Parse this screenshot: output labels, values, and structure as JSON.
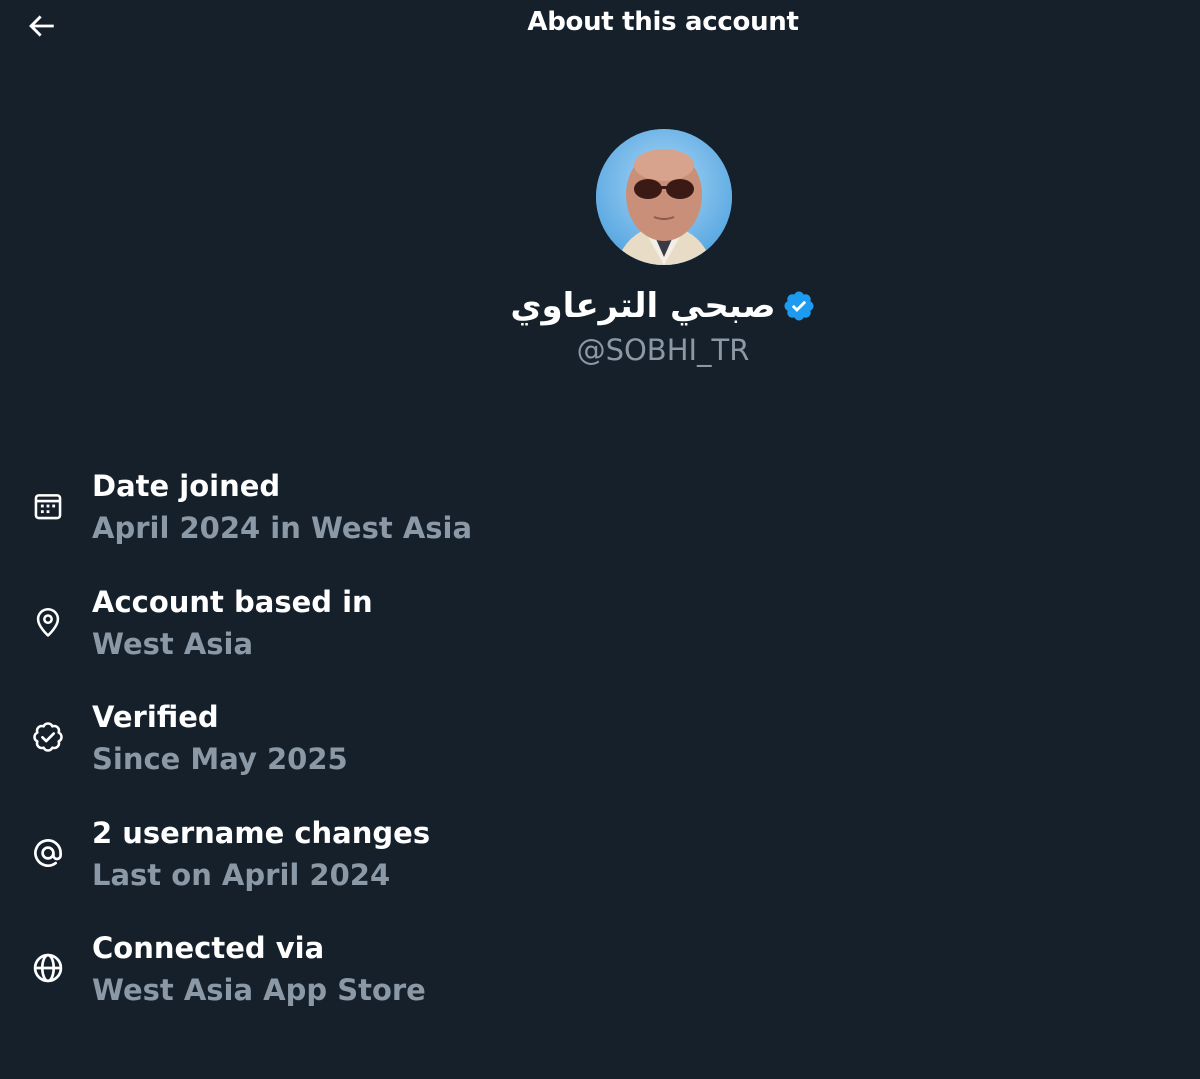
{
  "header": {
    "title": "About this account",
    "back_icon": "arrow-left-icon"
  },
  "profile": {
    "display_name": "صبحي الترعاوي",
    "handle": "@SOBHI_TR",
    "verified": true,
    "badge_color": "#1d9bf0"
  },
  "details": [
    {
      "icon": "calendar-icon",
      "title": "Date joined",
      "value": "April 2024 in West Asia"
    },
    {
      "icon": "location-pin-icon",
      "title": "Account based in",
      "value": "West Asia"
    },
    {
      "icon": "verified-badge-icon",
      "title": "Verified",
      "value": "Since May 2025"
    },
    {
      "icon": "at-sign-icon",
      "title": "2 username changes",
      "value": "Last on April 2024"
    },
    {
      "icon": "globe-icon",
      "title": "Connected via",
      "value": "West Asia App Store"
    }
  ],
  "colors": {
    "background": "#15202b",
    "primary_text": "#ffffff",
    "secondary_text": "#8b98a5",
    "accent": "#1d9bf0"
  }
}
